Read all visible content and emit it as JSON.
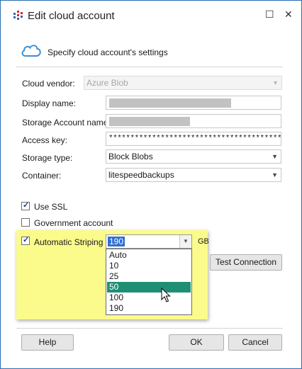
{
  "window": {
    "title": "Edit cloud account"
  },
  "header": {
    "text": "Specify cloud account's settings"
  },
  "form": {
    "cloud_vendor": {
      "label": "Cloud vendor:",
      "value": "Azure Blob"
    },
    "display_name": {
      "label": "Display name:"
    },
    "storage_account_name": {
      "label": "Storage Account name:"
    },
    "access_key": {
      "label": "Access key:",
      "value": "****************************************"
    },
    "storage_type": {
      "label": "Storage type:",
      "value": "Block Blobs"
    },
    "container": {
      "label": "Container:",
      "value": "litespeedbackups"
    }
  },
  "options": {
    "use_ssl": {
      "label": "Use SSL",
      "checked": true
    },
    "government_account": {
      "label": "Government account",
      "checked": false
    },
    "automatic_striping": {
      "label": "Automatic Striping",
      "checked": true,
      "value": "190",
      "unit": "GB"
    }
  },
  "striping_dropdown": {
    "options": [
      "Auto",
      "10",
      "25",
      "50",
      "100",
      "190"
    ],
    "highlighted": "50"
  },
  "buttons": {
    "test_connection": "Test Connection",
    "help": "Help",
    "ok": "OK",
    "cancel": "Cancel"
  },
  "icons": {
    "app": "app-logo-icon",
    "cloud": "cloud-icon",
    "maximize": "maximize-icon",
    "close": "close-icon"
  },
  "colors": {
    "window_border": "#2b6fb6",
    "highlight": "#fbfb8c",
    "selection": "#1f8f74",
    "combo_selection": "#2f6ed2",
    "cloud": "#3a8fd8"
  }
}
